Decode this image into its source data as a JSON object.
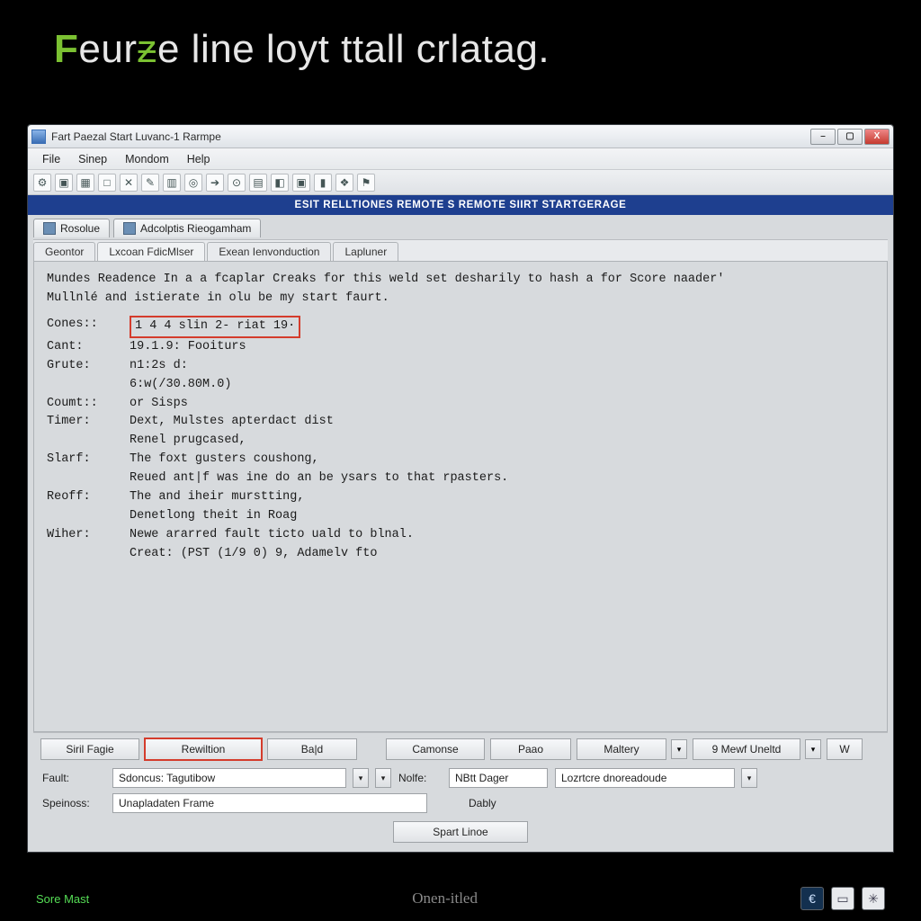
{
  "heading_parts": {
    "f": "F",
    "mid1": "eur",
    "z": "ƶ",
    "rest": "e line loyt ttall crlatag."
  },
  "window": {
    "title": "Fart Paezal Start Luvanc-1 Rarmpe",
    "win_min": "–",
    "win_max": "▢",
    "win_close": "X"
  },
  "menu": {
    "file": "File",
    "sinep": "Sinep",
    "mondom": "Mondom",
    "help": "Help"
  },
  "toolbar_icons": [
    "⚙",
    "▣",
    "▦",
    "□",
    "✕",
    "✎",
    "▥",
    "◎",
    "➔",
    "⊙",
    "▤",
    "◧",
    "▣",
    "▮",
    "❖",
    "⚑"
  ],
  "banner": "ESIT RELLTIONES REMOTE S REMOTE SIIRT STARTGERAGE",
  "upper_tabs": [
    {
      "label": "Rosolue"
    },
    {
      "label": "Adcolptis Rieogamham"
    }
  ],
  "lower_tabs": [
    {
      "label": "Geontor"
    },
    {
      "label": "Lxcoan FdicMlser",
      "active": true
    },
    {
      "label": "Exean Ienvonduction"
    },
    {
      "label": "Lapluner"
    }
  ],
  "content": {
    "intro": "Mundes Readence In a a fcaplar Creaks for this weld set desharily to hash a for Score naader'\nMullnlé and istierate in olu be my start faurt.",
    "rows": [
      {
        "k": "Cones::",
        "v_hl": "1 4 4 slin 2- riat 19·"
      },
      {
        "k": "Cant:",
        "v": "19.1.9: Fooiturs"
      },
      {
        "k": "Grute:",
        "v": "n1:2s d:"
      },
      {
        "k": "",
        "v": "6:w(/30.80M.0)"
      },
      {
        "k": "Coumt::",
        "v": "or Sisps"
      },
      {
        "k": "Timer:",
        "v": "Dext, Mulstes apterdact dist"
      },
      {
        "k": "",
        "v": "Renel prugcased,"
      },
      {
        "k": "Slarf:",
        "v": "The foxt gusters coushong,"
      },
      {
        "k": "",
        "v": "Reued ant|f was ine do an be ysars to that rpasters."
      },
      {
        "k": "Reoff:",
        "v": "The and iheir murstting,"
      },
      {
        "k": "",
        "v": "Denetlong theit in Roag"
      },
      {
        "k": "Wiher:",
        "v": "Newe ararred fault ticto uald to blnal."
      },
      {
        "k": "",
        "v": "Creat: (PST (1/9 0) 9, Adamelv fto"
      }
    ]
  },
  "buttons": {
    "siril": "Siril Fagie",
    "rewiltion": "Rewiltion",
    "bald": "Ba|d",
    "camonse": "Camonse",
    "paao": "Paao",
    "maltery": "Maltery",
    "mew": "9 Mewf Uneltd",
    "w": "W"
  },
  "fields": {
    "fault_label": "Fault:",
    "fault_value": "Sdoncus: Tagutibow",
    "note_label": "Nolfe:",
    "note_value": "NBtt Dager",
    "loz_value": "Lozrtcre dnoreadoude",
    "spe_label": "Speinoss:",
    "spe_value": "Unapladaten Frame",
    "dably": "Dably"
  },
  "spart_button": "Spart Linoe",
  "status": {
    "left": "Sore  Mast",
    "center": "Onen-itled",
    "euro": "€"
  }
}
